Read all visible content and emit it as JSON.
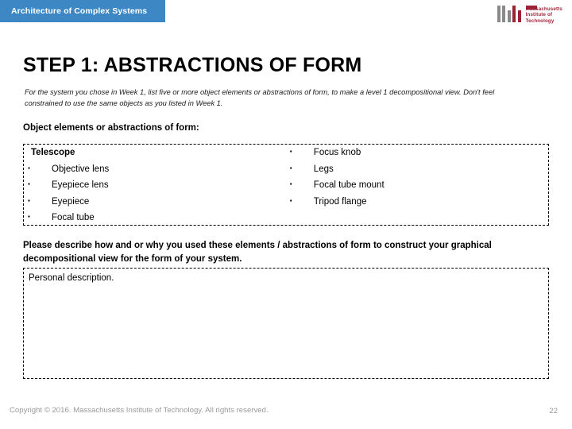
{
  "header": {
    "banner_label": "Architecture of Complex Systems",
    "banner_color": "#3c87c4",
    "logo": {
      "name": "mit-logo",
      "wordmark_line1": "Massachusetts",
      "wordmark_line2": "Institute of",
      "wordmark_line3": "Technology",
      "mark_gray": "#8a8a8a",
      "mark_red": "#9b2335"
    }
  },
  "slide": {
    "title": "STEP 1: ABSTRACTIONS OF FORM",
    "instruction": "For the system you chose in Week 1, list five or more object elements or abstractions of form, to make a level 1 decompositional view.  Don't feel constrained to use the same objects as you listed  in Week 1.",
    "section_heading": "Object elements or abstractions of form:",
    "describe_prompt": "Please describe how and or why you used these elements / abstractions of form to construct your graphical decompositional view for the form of your system.",
    "personal_description": "Personal description."
  },
  "elements": {
    "bullet_glyph": "▪",
    "left_column": [
      {
        "label": "Telescope",
        "bulleted": false,
        "bold": true
      },
      {
        "label": "Objective lens",
        "bulleted": true,
        "bold": false
      },
      {
        "label": "Eyepiece lens",
        "bulleted": true,
        "bold": false
      },
      {
        "label": "Eyepiece",
        "bulleted": true,
        "bold": false
      },
      {
        "label": "Focal tube",
        "bulleted": true,
        "bold": false
      }
    ],
    "right_column": [
      {
        "label": "Focus knob",
        "bulleted": true,
        "bold": false
      },
      {
        "label": "Legs",
        "bulleted": true,
        "bold": false
      },
      {
        "label": "Focal tube mount",
        "bulleted": true,
        "bold": false
      },
      {
        "label": "Tripod flange",
        "bulleted": true,
        "bold": false
      }
    ]
  },
  "footer": {
    "copyright": "Copyright © 2016. Massachusetts Institute of Technology. All rights reserved.",
    "page_number": "22",
    "text_color": "#9a9a9a"
  }
}
